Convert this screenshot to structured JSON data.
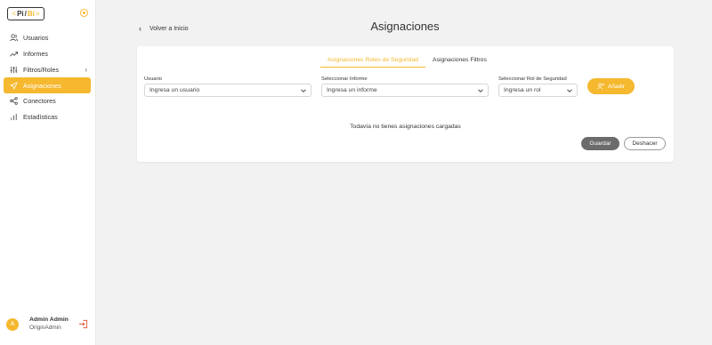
{
  "sidebar": {
    "logo": {
      "pi": "Pi",
      "bi": "Bi",
      "left_angle": "<",
      "slash": "/",
      "right_angle": ">"
    },
    "items": [
      {
        "label": "Usuarios",
        "icon": "users-icon"
      },
      {
        "label": "Informes",
        "icon": "trend-icon"
      },
      {
        "label": "Filtros/Roles",
        "icon": "sliders-icon"
      },
      {
        "label": "Asignaciones",
        "icon": "send-icon"
      },
      {
        "label": "Conectores",
        "icon": "share-icon"
      },
      {
        "label": "Estadísticas",
        "icon": "bar-chart-icon"
      }
    ],
    "active_index": 3,
    "user": {
      "avatar_letter": "A",
      "name": "Admin Admin",
      "role": "OriginAdmin"
    }
  },
  "header": {
    "back_label": "Volver a Inicio",
    "title": "Asignaciones"
  },
  "card": {
    "tabs": [
      {
        "label": "Asignaciones Roles de Seguridad",
        "active": true
      },
      {
        "label": "Asignaciones Filtros",
        "active": false
      }
    ],
    "fields": {
      "usuario": {
        "label": "Usuario",
        "placeholder": "Ingresa un usuario"
      },
      "informe": {
        "label": "Seleccionar Informe",
        "placeholder": "Ingresa un informe"
      },
      "rol": {
        "label": "Seleccionar Rol de Seguridad",
        "placeholder": "Ingresa un rol"
      }
    },
    "add_label": "Añadir",
    "empty_message": "Todavía no tienes asignaciones cargadas",
    "save_label": "Guardar",
    "undo_label": "Deshacer"
  },
  "colors": {
    "accent": "#f5b82e",
    "save_button": "#6b6b6b",
    "background": "#f2f2f2"
  }
}
